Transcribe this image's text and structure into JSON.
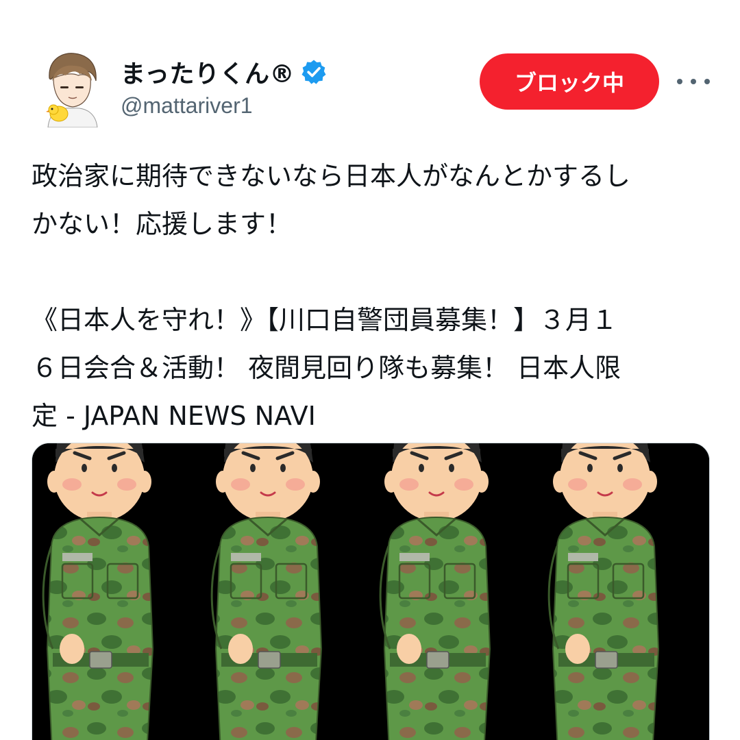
{
  "user": {
    "display_name": "まったりくん®",
    "handle": "@mattariver1",
    "verified": true,
    "avatar_icon": "avatar-illustration"
  },
  "actions": {
    "block_label": "ブロック中",
    "more_icon": "more-icon"
  },
  "tweet": {
    "text": "政治家に期待できないなら日本人がなんとかするし\nかない！応援します！\n\n《日本人を守れ！》【川口自警団員募集！】３月１\n６日会合＆活動！ 夜間見回り隊も募集！ 日本人限\n定 - JAPAN NEWS NAVI"
  },
  "media": {
    "type": "illustration",
    "description_icon": "soldiers-illustration",
    "background_color": "#000000"
  },
  "colors": {
    "block_button": "#f4212e",
    "verified": "#1d9bf0",
    "secondary_text": "#536471"
  }
}
